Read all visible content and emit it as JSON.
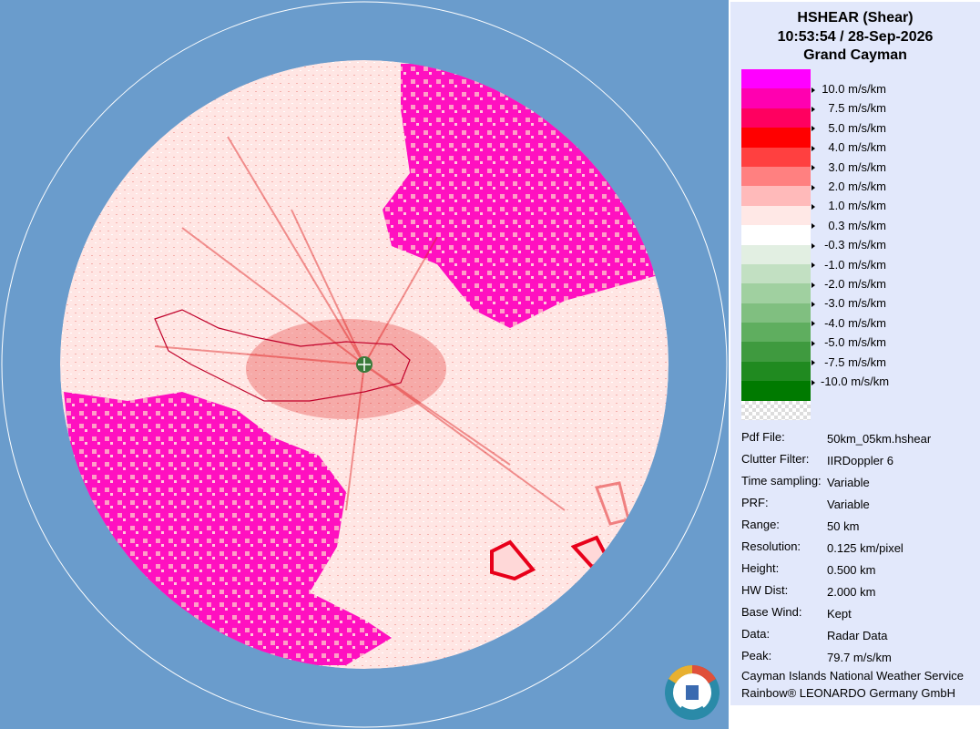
{
  "header": {
    "product": "HSHEAR (Shear)",
    "datetime": "10:53:54 / 28-Sep-2026",
    "site": "Grand Cayman"
  },
  "legend": {
    "unit": "m/s/km",
    "colors": [
      "#ff00ff",
      "#ff00b0",
      "#ff0060",
      "#ff0000",
      "#ff4040",
      "#ff8080",
      "#ffbaba",
      "#ffe8e6",
      "#ffffff",
      "#e2efe2",
      "#c2e0c2",
      "#a0d0a0",
      "#80bf80",
      "#5fae5f",
      "#3f9a3f",
      "#208a20",
      "#007a00"
    ],
    "labels": [
      "10.0 m/s/km",
      "7.5 m/s/km",
      "5.0 m/s/km",
      "4.0 m/s/km",
      "3.0 m/s/km",
      "2.0 m/s/km",
      "1.0 m/s/km",
      "0.3 m/s/km",
      "-0.3 m/s/km",
      "-1.0 m/s/km",
      "-2.0 m/s/km",
      "-3.0 m/s/km",
      "-4.0 m/s/km",
      "-5.0 m/s/km",
      "-7.5 m/s/km",
      "-10.0 m/s/km"
    ]
  },
  "info": [
    {
      "key": "Pdf File:",
      "value": "50km_05km.hshear"
    },
    {
      "key": "Clutter Filter:",
      "value": "IIRDoppler 6"
    },
    {
      "key": "Time sampling:",
      "value": "Variable"
    },
    {
      "key": "PRF:",
      "value": "Variable"
    },
    {
      "key": "Range:",
      "value": "50 km"
    },
    {
      "key": "Resolution:",
      "value": "0.125 km/pixel"
    },
    {
      "key": "Height:",
      "value": "0.500 km"
    },
    {
      "key": "HW Dist:",
      "value": "2.000 km"
    },
    {
      "key": "Base Wind:",
      "value": "Kept"
    },
    {
      "key": "Data:",
      "value": "Radar Data"
    },
    {
      "key": "Peak:",
      "value": "79.7 m/s/km"
    }
  ],
  "footer": {
    "line1": "Cayman Islands National Weather Service",
    "line2": "Rainbow® LEONARDO Germany GmbH"
  },
  "colors": {
    "background": "#6a9ccc",
    "field_base": "#ffe8e6",
    "high_shear": "#ff10c0",
    "shear_red": "#e01010",
    "radar_marker": "#3a7a3a"
  }
}
